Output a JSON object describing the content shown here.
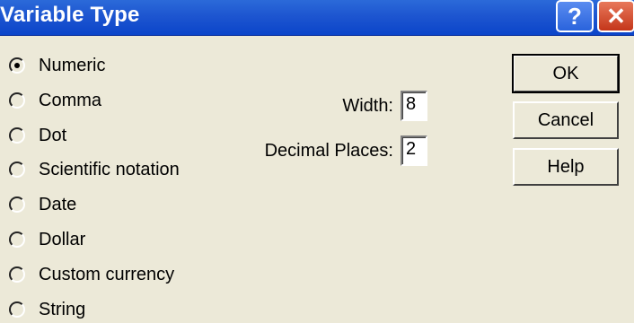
{
  "window": {
    "title": "Variable Type",
    "help_glyph": "?",
    "close_glyph": "✕"
  },
  "types": [
    {
      "label": "Numeric",
      "selected": true
    },
    {
      "label": "Comma",
      "selected": false
    },
    {
      "label": "Dot",
      "selected": false
    },
    {
      "label": "Scientific notation",
      "selected": false
    },
    {
      "label": "Date",
      "selected": false
    },
    {
      "label": "Dollar",
      "selected": false
    },
    {
      "label": "Custom currency",
      "selected": false
    },
    {
      "label": "String",
      "selected": false
    }
  ],
  "fields": {
    "width_label": "Width:",
    "width_value": "8",
    "decimals_label": "Decimal Places:",
    "decimals_value": "2"
  },
  "buttons": {
    "ok": "OK",
    "cancel": "Cancel",
    "help": "Help"
  },
  "colors": {
    "title_bar": "#0a44c9",
    "dialog_bg": "#ece9d8",
    "close_button": "#c4361a"
  }
}
